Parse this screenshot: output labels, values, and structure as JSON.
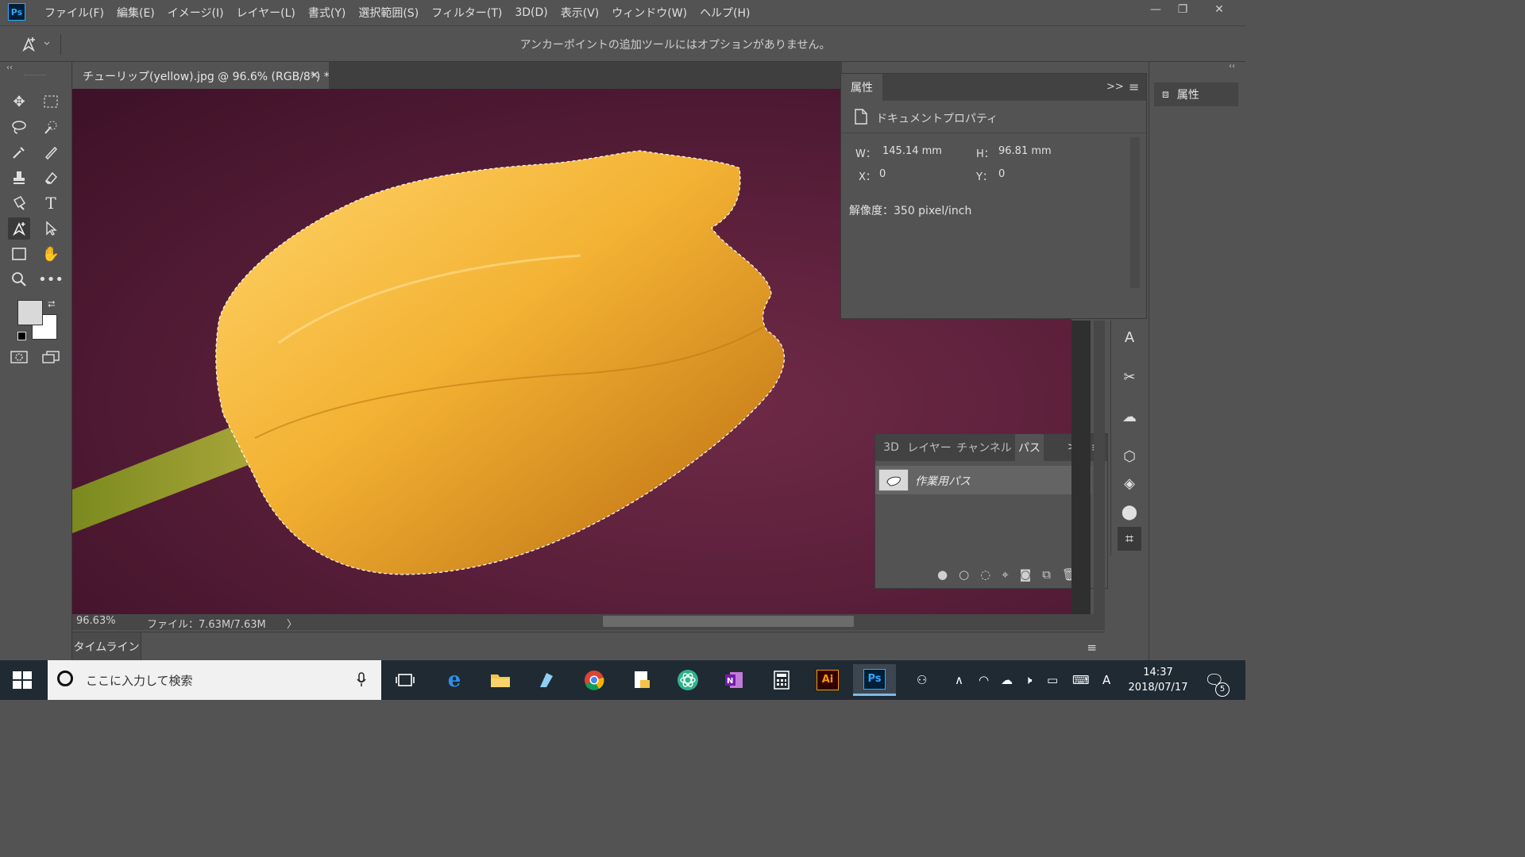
{
  "app": {
    "logo": "Ps"
  },
  "menu": [
    "ファイル(F)",
    "編集(E)",
    "イメージ(I)",
    "レイヤー(L)",
    "書式(Y)",
    "選択範囲(S)",
    "フィルター(T)",
    "3D(D)",
    "表示(V)",
    "ウィンドウ(W)",
    "ヘルプ(H)"
  ],
  "window_controls": {
    "minimize": "—",
    "restore": "❐",
    "close": "✕"
  },
  "options_bar": {
    "message": "アンカーポイントの追加ツールにはオプションがありません。"
  },
  "document": {
    "tab_title": "チューリップ(yellow).jpg @ 96.6% (RGB/8*) *",
    "close_glyph": "×"
  },
  "status": {
    "zoom": "96.63%",
    "file_info": "ファイル：7.63M/7.63M",
    "arrow": "〉"
  },
  "timeline": {
    "tab_label": "タイムライン"
  },
  "properties_panel": {
    "tab_label": "属性",
    "section_title": "ドキュメントプロパティ",
    "w_label": "W：",
    "w_value": "145.14 mm",
    "h_label": "H：",
    "h_value": "96.81 mm",
    "x_label": "X：",
    "x_value": "0",
    "y_label": "Y：",
    "y_value": "0",
    "resolution": "解像度：350 pixel/inch",
    "expand_glyph": ">>"
  },
  "paths_panel": {
    "tabs": [
      "3D",
      "レイヤー",
      "チャンネル",
      "パス"
    ],
    "active_tab": "パス",
    "items": [
      {
        "name": "作業用パス"
      }
    ]
  },
  "right_collapsed": {
    "button_label": "属性"
  },
  "taskbar": {
    "search_placeholder": "ここに入力して検索",
    "apps": [
      "task-view",
      "edge",
      "explorer",
      "notes",
      "chrome",
      "files",
      "atom",
      "onenote",
      "calculator",
      "illustrator",
      "photoshop"
    ],
    "ai_label": "Ai",
    "ps_label": "Ps",
    "time": "14:37",
    "date": "2018/07/17",
    "notification_count": "5",
    "ime": "A"
  },
  "colors": {
    "accent": "#31a8ff",
    "panel": "#535353",
    "dark": "#3a3a3a",
    "taskbar": "#1f2a33"
  }
}
